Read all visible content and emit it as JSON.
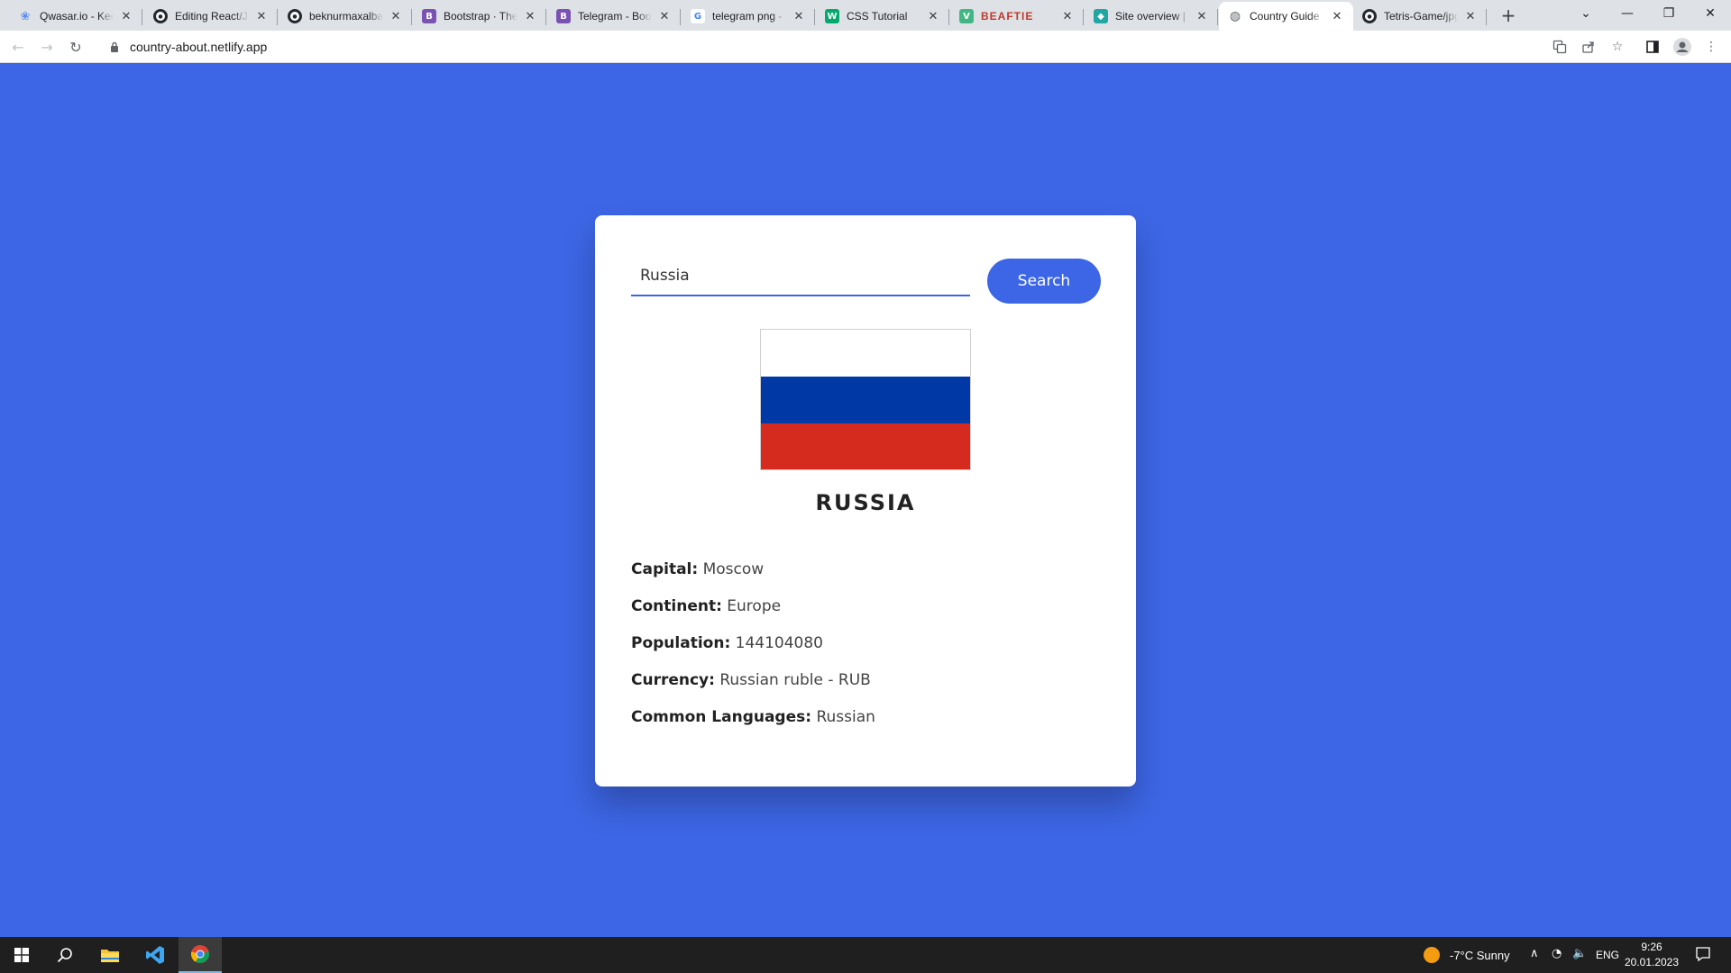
{
  "browser": {
    "tabs": [
      {
        "title": "Qwasar.io - Keep",
        "icon": "qwasar-icon",
        "color": "#5b8def",
        "glyph": "❀",
        "active": false
      },
      {
        "title": "Editing React/JS",
        "icon": "github-icon",
        "color": "#24292f",
        "glyph": "●",
        "active": false
      },
      {
        "title": "beknurmaxalbay",
        "icon": "github-icon",
        "color": "#24292f",
        "glyph": "●",
        "active": false
      },
      {
        "title": "Bootstrap · The",
        "icon": "bootstrap-icon",
        "color": "#7952b3",
        "glyph": "B",
        "active": false
      },
      {
        "title": "Telegram - Boot",
        "icon": "bootstrap-icon",
        "color": "#7952b3",
        "glyph": "B",
        "active": false
      },
      {
        "title": "telegram png -",
        "icon": "google-icon",
        "color": "#ffffff",
        "glyph": "G",
        "active": false
      },
      {
        "title": "CSS Tutorial",
        "icon": "w3schools-icon",
        "color": "#04aa6d",
        "glyph": "W",
        "active": false
      },
      {
        "title": "BEAFTIE",
        "icon": "vue-icon",
        "color": "#41b883",
        "glyph": "V",
        "active": false
      },
      {
        "title": "Site overview | d",
        "icon": "netlify-icon",
        "color": "#20a7a4",
        "glyph": "◆",
        "active": false
      },
      {
        "title": "Country Guide",
        "icon": "globe-icon",
        "color": "#5f6368",
        "glyph": "◍",
        "active": true
      },
      {
        "title": "Tetris-Game/jpg",
        "icon": "github-icon",
        "color": "#24292f",
        "glyph": "●",
        "active": false
      }
    ],
    "new_tab": "+",
    "url": "country-about.netlify.app"
  },
  "page": {
    "search_value": "Russia",
    "search_button": "Search",
    "country_name": "RUSSIA",
    "flag_colors": [
      "#ffffff",
      "#0039a6",
      "#d52b1e"
    ],
    "accent_color": "#3d66e6",
    "info": [
      {
        "label": "Capital:",
        "value": "Moscow"
      },
      {
        "label": "Continent:",
        "value": "Europe"
      },
      {
        "label": "Population:",
        "value": "144104080"
      },
      {
        "label": "Currency:",
        "value": "Russian ruble - RUB"
      },
      {
        "label": "Common Languages:",
        "value": "Russian"
      }
    ]
  },
  "taskbar": {
    "apps": [
      "windows-start-icon",
      "search-icon",
      "file-explorer-icon",
      "vscode-icon",
      "chrome-icon"
    ],
    "weather": "-7°C  Sunny",
    "language": "ENG",
    "time": "9:26",
    "date": "20.01.2023"
  }
}
